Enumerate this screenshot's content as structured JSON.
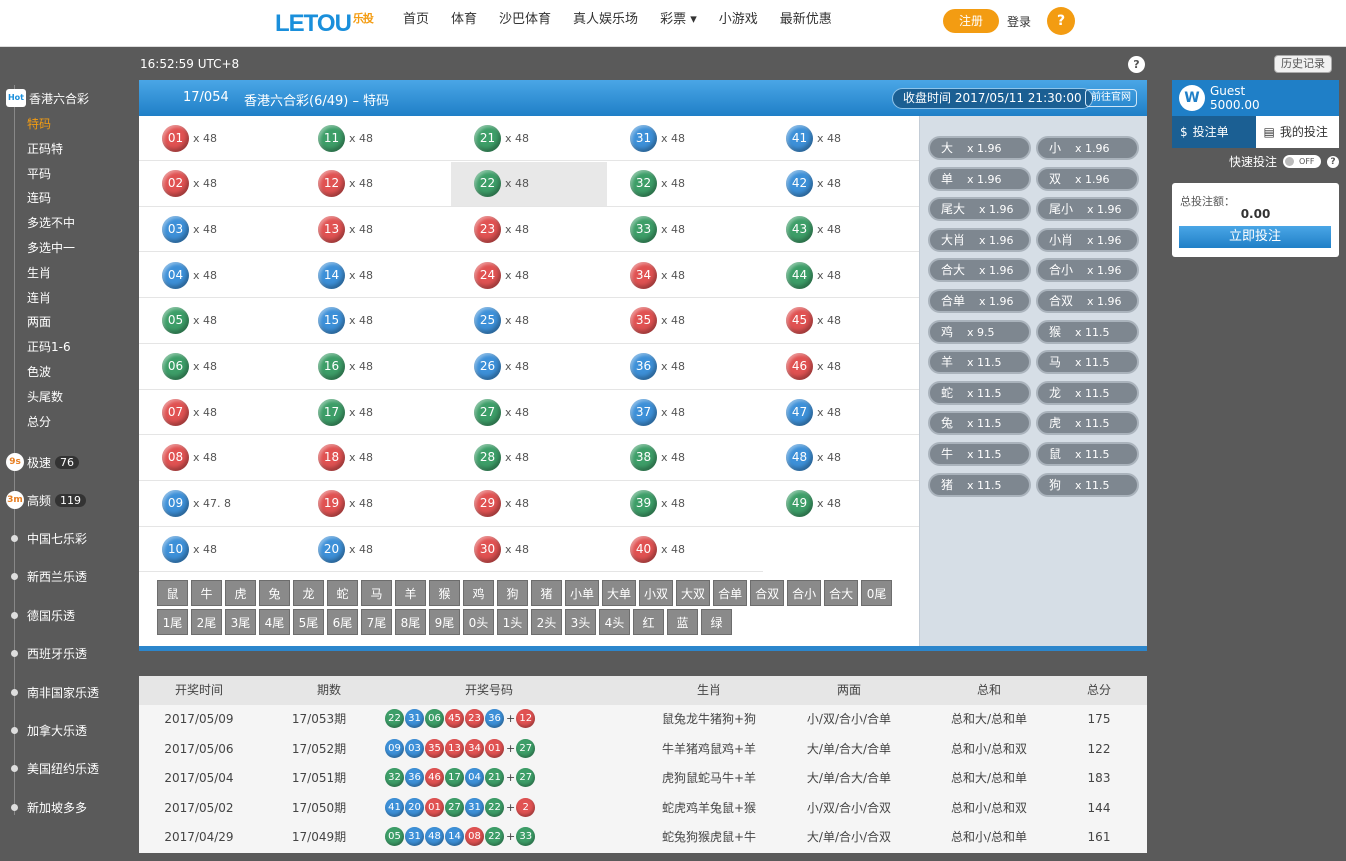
{
  "header": {
    "logo": "LETOU",
    "logo_sub": "乐投",
    "nav": [
      "首页",
      "体育",
      "沙巴体育",
      "真人娱乐场",
      "彩票 ▾",
      "小游戏",
      "最新优惠"
    ],
    "register": "注册",
    "login": "登录"
  },
  "clock": "16:52:59 UTC+8",
  "history_btn": "历史记录",
  "sidebar": {
    "hk_title": "香港六合彩",
    "hk_badge": "Hot",
    "hk_items": [
      "特码",
      "正码特",
      "平码",
      "连码",
      "多选不中",
      "多选中一",
      "生肖",
      "连肖",
      "两面",
      "正码1-6",
      "色波",
      "头尾数",
      "总分"
    ],
    "groups": [
      {
        "badge": "9s",
        "label": "极速",
        "count": "76"
      },
      {
        "badge": "3m",
        "label": "高频",
        "count": "119"
      }
    ],
    "countries": [
      "中国七乐彩",
      "新西兰乐透",
      "德国乐透",
      "西班牙乐透",
      "南非国家乐透",
      "加拿大乐透",
      "美国纽约乐透",
      "新加坡多多"
    ]
  },
  "panel": {
    "issue": "17/054",
    "game": "香港六合彩(6/49) – 特码",
    "close_time": "收盘时间 2017/05/11 21:30:00",
    "official_link": "前往官网"
  },
  "number_cells": [
    {
      "n": "01",
      "c": "red",
      "o": "x 48"
    },
    {
      "n": "11",
      "c": "green",
      "o": "x 48"
    },
    {
      "n": "21",
      "c": "green",
      "o": "x 48"
    },
    {
      "n": "31",
      "c": "blue",
      "o": "x 48"
    },
    {
      "n": "41",
      "c": "blue",
      "o": "x 48"
    },
    {
      "n": "02",
      "c": "red",
      "o": "x 48"
    },
    {
      "n": "12",
      "c": "red",
      "o": "x 48"
    },
    {
      "n": "22",
      "c": "green",
      "o": "x 48",
      "sel": true
    },
    {
      "n": "32",
      "c": "green",
      "o": "x 48"
    },
    {
      "n": "42",
      "c": "blue",
      "o": "x 48"
    },
    {
      "n": "03",
      "c": "blue",
      "o": "x 48"
    },
    {
      "n": "13",
      "c": "red",
      "o": "x 48"
    },
    {
      "n": "23",
      "c": "red",
      "o": "x 48"
    },
    {
      "n": "33",
      "c": "green",
      "o": "x 48"
    },
    {
      "n": "43",
      "c": "green",
      "o": "x 48"
    },
    {
      "n": "04",
      "c": "blue",
      "o": "x 48"
    },
    {
      "n": "14",
      "c": "blue",
      "o": "x 48"
    },
    {
      "n": "24",
      "c": "red",
      "o": "x 48"
    },
    {
      "n": "34",
      "c": "red",
      "o": "x 48"
    },
    {
      "n": "44",
      "c": "green",
      "o": "x 48"
    },
    {
      "n": "05",
      "c": "green",
      "o": "x 48"
    },
    {
      "n": "15",
      "c": "blue",
      "o": "x 48"
    },
    {
      "n": "25",
      "c": "blue",
      "o": "x 48"
    },
    {
      "n": "35",
      "c": "red",
      "o": "x 48"
    },
    {
      "n": "45",
      "c": "red",
      "o": "x 48"
    },
    {
      "n": "06",
      "c": "green",
      "o": "x 48"
    },
    {
      "n": "16",
      "c": "green",
      "o": "x 48"
    },
    {
      "n": "26",
      "c": "blue",
      "o": "x 48"
    },
    {
      "n": "36",
      "c": "blue",
      "o": "x 48"
    },
    {
      "n": "46",
      "c": "red",
      "o": "x 48"
    },
    {
      "n": "07",
      "c": "red",
      "o": "x 48"
    },
    {
      "n": "17",
      "c": "green",
      "o": "x 48"
    },
    {
      "n": "27",
      "c": "green",
      "o": "x 48"
    },
    {
      "n": "37",
      "c": "blue",
      "o": "x 48"
    },
    {
      "n": "47",
      "c": "blue",
      "o": "x 48"
    },
    {
      "n": "08",
      "c": "red",
      "o": "x 48"
    },
    {
      "n": "18",
      "c": "red",
      "o": "x 48"
    },
    {
      "n": "28",
      "c": "green",
      "o": "x 48"
    },
    {
      "n": "38",
      "c": "green",
      "o": "x 48"
    },
    {
      "n": "48",
      "c": "blue",
      "o": "x 48"
    },
    {
      "n": "09",
      "c": "blue",
      "o": "x 47. 8"
    },
    {
      "n": "19",
      "c": "red",
      "o": "x 48"
    },
    {
      "n": "29",
      "c": "red",
      "o": "x 48"
    },
    {
      "n": "39",
      "c": "green",
      "o": "x 48"
    },
    {
      "n": "49",
      "c": "green",
      "o": "x 48"
    },
    {
      "n": "10",
      "c": "blue",
      "o": "x 48"
    },
    {
      "n": "20",
      "c": "blue",
      "o": "x 48"
    },
    {
      "n": "30",
      "c": "red",
      "o": "x 48"
    },
    {
      "n": "40",
      "c": "red",
      "o": "x 48"
    }
  ],
  "chips": [
    "鼠",
    "牛",
    "虎",
    "兔",
    "龙",
    "蛇",
    "马",
    "羊",
    "猴",
    "鸡",
    "狗",
    "猪",
    "小单",
    "大单",
    "小双",
    "大双",
    "合单",
    "合双",
    "合小",
    "合大",
    "0尾",
    "1尾",
    "2尾",
    "3尾",
    "4尾",
    "5尾",
    "6尾",
    "7尾",
    "8尾",
    "9尾",
    "0头",
    "1头",
    "2头",
    "3头",
    "4头",
    "红",
    "蓝",
    "绿"
  ],
  "side_pills": [
    [
      "大",
      "x 1.96"
    ],
    [
      "小",
      "x 1.96"
    ],
    [
      "单",
      "x 1.96"
    ],
    [
      "双",
      "x 1.96"
    ],
    [
      "尾大",
      "x 1.96"
    ],
    [
      "尾小",
      "x 1.96"
    ],
    [
      "大肖",
      "x 1.96"
    ],
    [
      "小肖",
      "x 1.96"
    ],
    [
      "合大",
      "x 1.96"
    ],
    [
      "合小",
      "x 1.96"
    ],
    [
      "合单",
      "x 1.96"
    ],
    [
      "合双",
      "x 1.96"
    ],
    [
      "鸡",
      "x 9.5"
    ],
    [
      "猴",
      "x 11.5"
    ],
    [
      "羊",
      "x 11.5"
    ],
    [
      "马",
      "x 11.5"
    ],
    [
      "蛇",
      "x 11.5"
    ],
    [
      "龙",
      "x 11.5"
    ],
    [
      "兔",
      "x 11.5"
    ],
    [
      "虎",
      "x 11.5"
    ],
    [
      "牛",
      "x 11.5"
    ],
    [
      "鼠",
      "x 11.5"
    ],
    [
      "猪",
      "x 11.5"
    ],
    [
      "狗",
      "x 11.5"
    ]
  ],
  "account": {
    "name": "Guest",
    "balance": "5000.00",
    "tab_bet": "投注单",
    "tab_mine": "我的投注",
    "quick_bet": "快速投注",
    "toggle": "OFF",
    "total_label": "总投注额：",
    "total_value": "0.00",
    "bet_btn": "立即投注"
  },
  "results": {
    "headers": [
      "开奖时间",
      "期数",
      "开奖号码",
      "生肖",
      "两面",
      "总和",
      "总分"
    ],
    "rows": [
      {
        "date": "2017/05/09",
        "issue": "17/053期",
        "balls": [
          [
            "22",
            "green"
          ],
          [
            "31",
            "blue"
          ],
          [
            "06",
            "green"
          ],
          [
            "45",
            "red"
          ],
          [
            "23",
            "red"
          ],
          [
            "36",
            "blue"
          ]
        ],
        "special": [
          "12",
          "red"
        ],
        "zodiac": "鼠兔龙牛猪狗+狗",
        "two": "小/双/合小/合单",
        "sum": "总和大/总和单",
        "score": "175"
      },
      {
        "date": "2017/05/06",
        "issue": "17/052期",
        "balls": [
          [
            "09",
            "blue"
          ],
          [
            "03",
            "blue"
          ],
          [
            "35",
            "red"
          ],
          [
            "13",
            "red"
          ],
          [
            "34",
            "red"
          ],
          [
            "01",
            "red"
          ]
        ],
        "special": [
          "27",
          "green"
        ],
        "zodiac": "牛羊猪鸡鼠鸡+羊",
        "two": "大/单/合大/合单",
        "sum": "总和小/总和双",
        "score": "122"
      },
      {
        "date": "2017/05/04",
        "issue": "17/051期",
        "balls": [
          [
            "32",
            "green"
          ],
          [
            "36",
            "blue"
          ],
          [
            "46",
            "red"
          ],
          [
            "17",
            "green"
          ],
          [
            "04",
            "blue"
          ],
          [
            "21",
            "green"
          ]
        ],
        "special": [
          "27",
          "green"
        ],
        "zodiac": "虎狗鼠蛇马牛+羊",
        "two": "大/单/合大/合单",
        "sum": "总和大/总和单",
        "score": "183"
      },
      {
        "date": "2017/05/02",
        "issue": "17/050期",
        "balls": [
          [
            "41",
            "blue"
          ],
          [
            "20",
            "blue"
          ],
          [
            "01",
            "red"
          ],
          [
            "27",
            "green"
          ],
          [
            "31",
            "blue"
          ],
          [
            "22",
            "green"
          ]
        ],
        "special": [
          "2",
          "red"
        ],
        "zodiac": "蛇虎鸡羊兔鼠+猴",
        "two": "小/双/合小/合双",
        "sum": "总和小/总和双",
        "score": "144"
      },
      {
        "date": "2017/04/29",
        "issue": "17/049期",
        "balls": [
          [
            "05",
            "green"
          ],
          [
            "31",
            "blue"
          ],
          [
            "48",
            "blue"
          ],
          [
            "14",
            "blue"
          ],
          [
            "08",
            "red"
          ],
          [
            "22",
            "green"
          ]
        ],
        "special": [
          "33",
          "green"
        ],
        "zodiac": "蛇兔狗猴虎鼠+牛",
        "two": "大/单/合小/合双",
        "sum": "总和小/总和单",
        "score": "161"
      }
    ]
  }
}
